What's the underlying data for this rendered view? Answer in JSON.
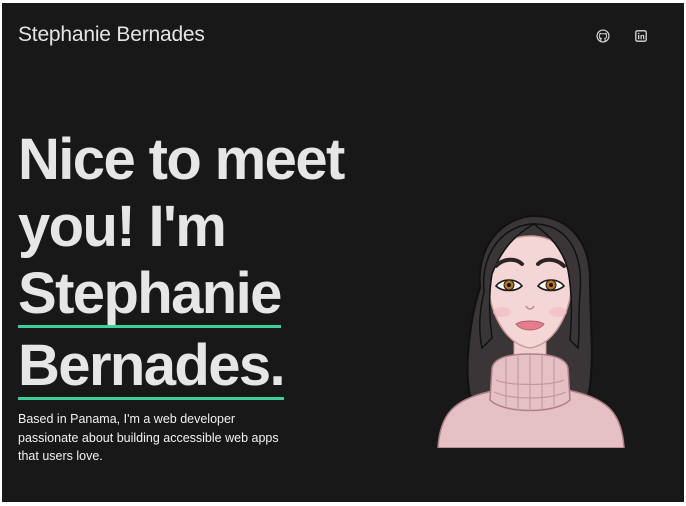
{
  "header": {
    "site_name": "Stephanie Bernades",
    "social": [
      {
        "icon": "github-icon"
      },
      {
        "icon": "linkedin-icon"
      }
    ]
  },
  "hero": {
    "line1": "Nice to meet",
    "line2": "you! I'm",
    "name_line1": "Stephanie",
    "name_line2": "Bernades."
  },
  "bio": {
    "text": "Based in Panama, I'm a web developer passionate about building accessible web apps that users love."
  },
  "colors": {
    "background": "#191819",
    "accent": "#3ecf9a",
    "text": "#e6e6e6"
  }
}
